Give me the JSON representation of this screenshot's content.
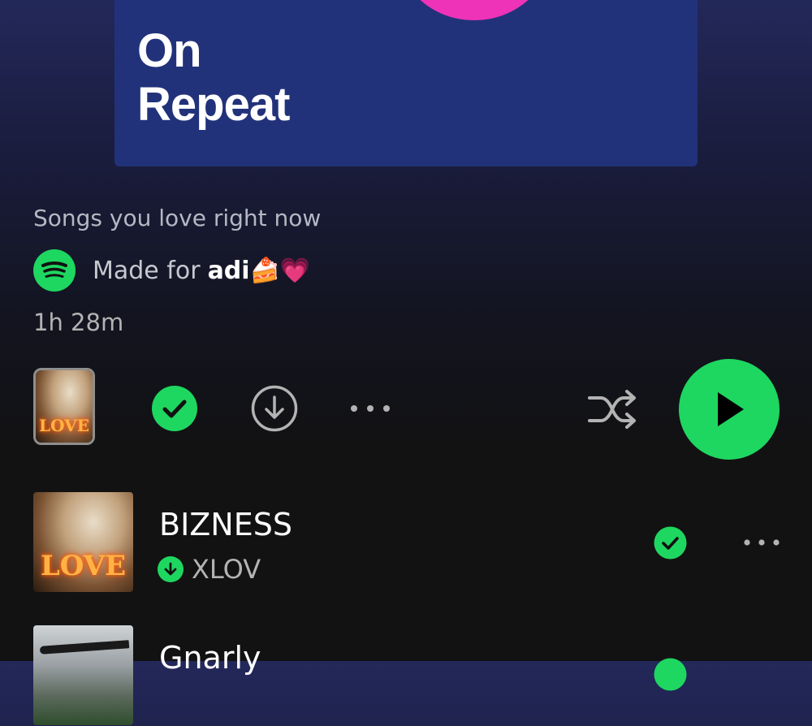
{
  "playlist": {
    "cover_title": "On\nRepeat",
    "description": "Songs you love right now",
    "made_for_prefix": "Made for",
    "made_for_user": "adi🍰💗",
    "duration": "1h 28m"
  },
  "toolbar": {
    "icons": [
      "playlist-cover-thumbnail",
      "saved-check-icon",
      "download-icon",
      "more-options-icon",
      "shuffle-icon",
      "play-icon"
    ]
  },
  "tracks": [
    {
      "title": "BIZNESS",
      "artist": "XLOV",
      "downloaded": true,
      "saved": true
    },
    {
      "title": "Gnarly",
      "artist": "",
      "downloaded": true,
      "saved": true
    }
  ],
  "colors": {
    "accent": "#1ed760",
    "cover_bg": "#22327a",
    "cover_blob": "#ee33b8",
    "bg": "#121212"
  }
}
